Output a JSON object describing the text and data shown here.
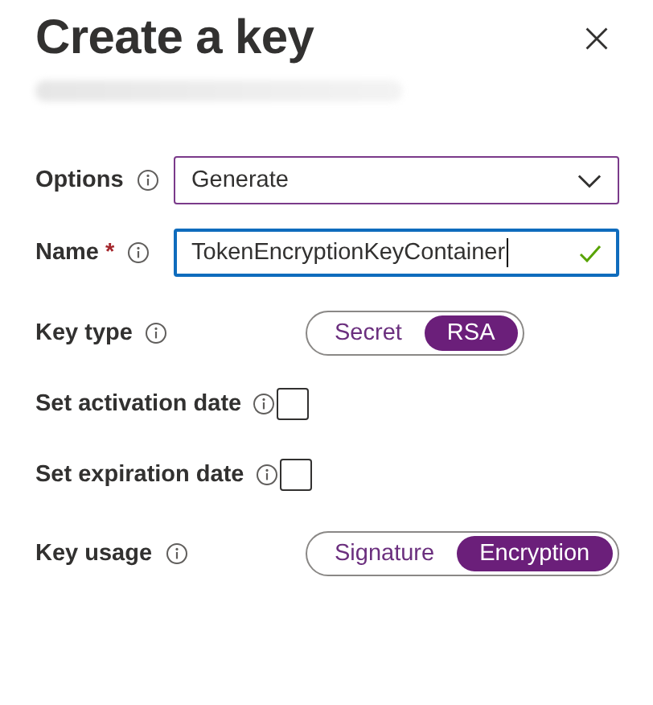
{
  "panel": {
    "title": "Create a key",
    "subtitle_redacted": true
  },
  "fields": [
    {
      "kind": "dropdown",
      "label": "Options",
      "value": "Generate"
    },
    {
      "kind": "text",
      "label": "Name",
      "required_mark": "*",
      "value": "TokenEncryptionKeyContainer",
      "valid": true,
      "focused": true
    },
    {
      "kind": "toggle",
      "label": "Key type",
      "options": [
        {
          "label": "Secret",
          "selected": false
        },
        {
          "label": "RSA",
          "selected": true
        }
      ]
    },
    {
      "kind": "checkbox",
      "label": "Set activation date",
      "checked": false
    },
    {
      "kind": "checkbox",
      "label": "Set expiration date",
      "checked": false
    },
    {
      "kind": "toggle",
      "label": "Key usage",
      "options": [
        {
          "label": "Signature",
          "selected": false
        },
        {
          "label": "Encryption",
          "selected": true
        }
      ]
    }
  ]
}
